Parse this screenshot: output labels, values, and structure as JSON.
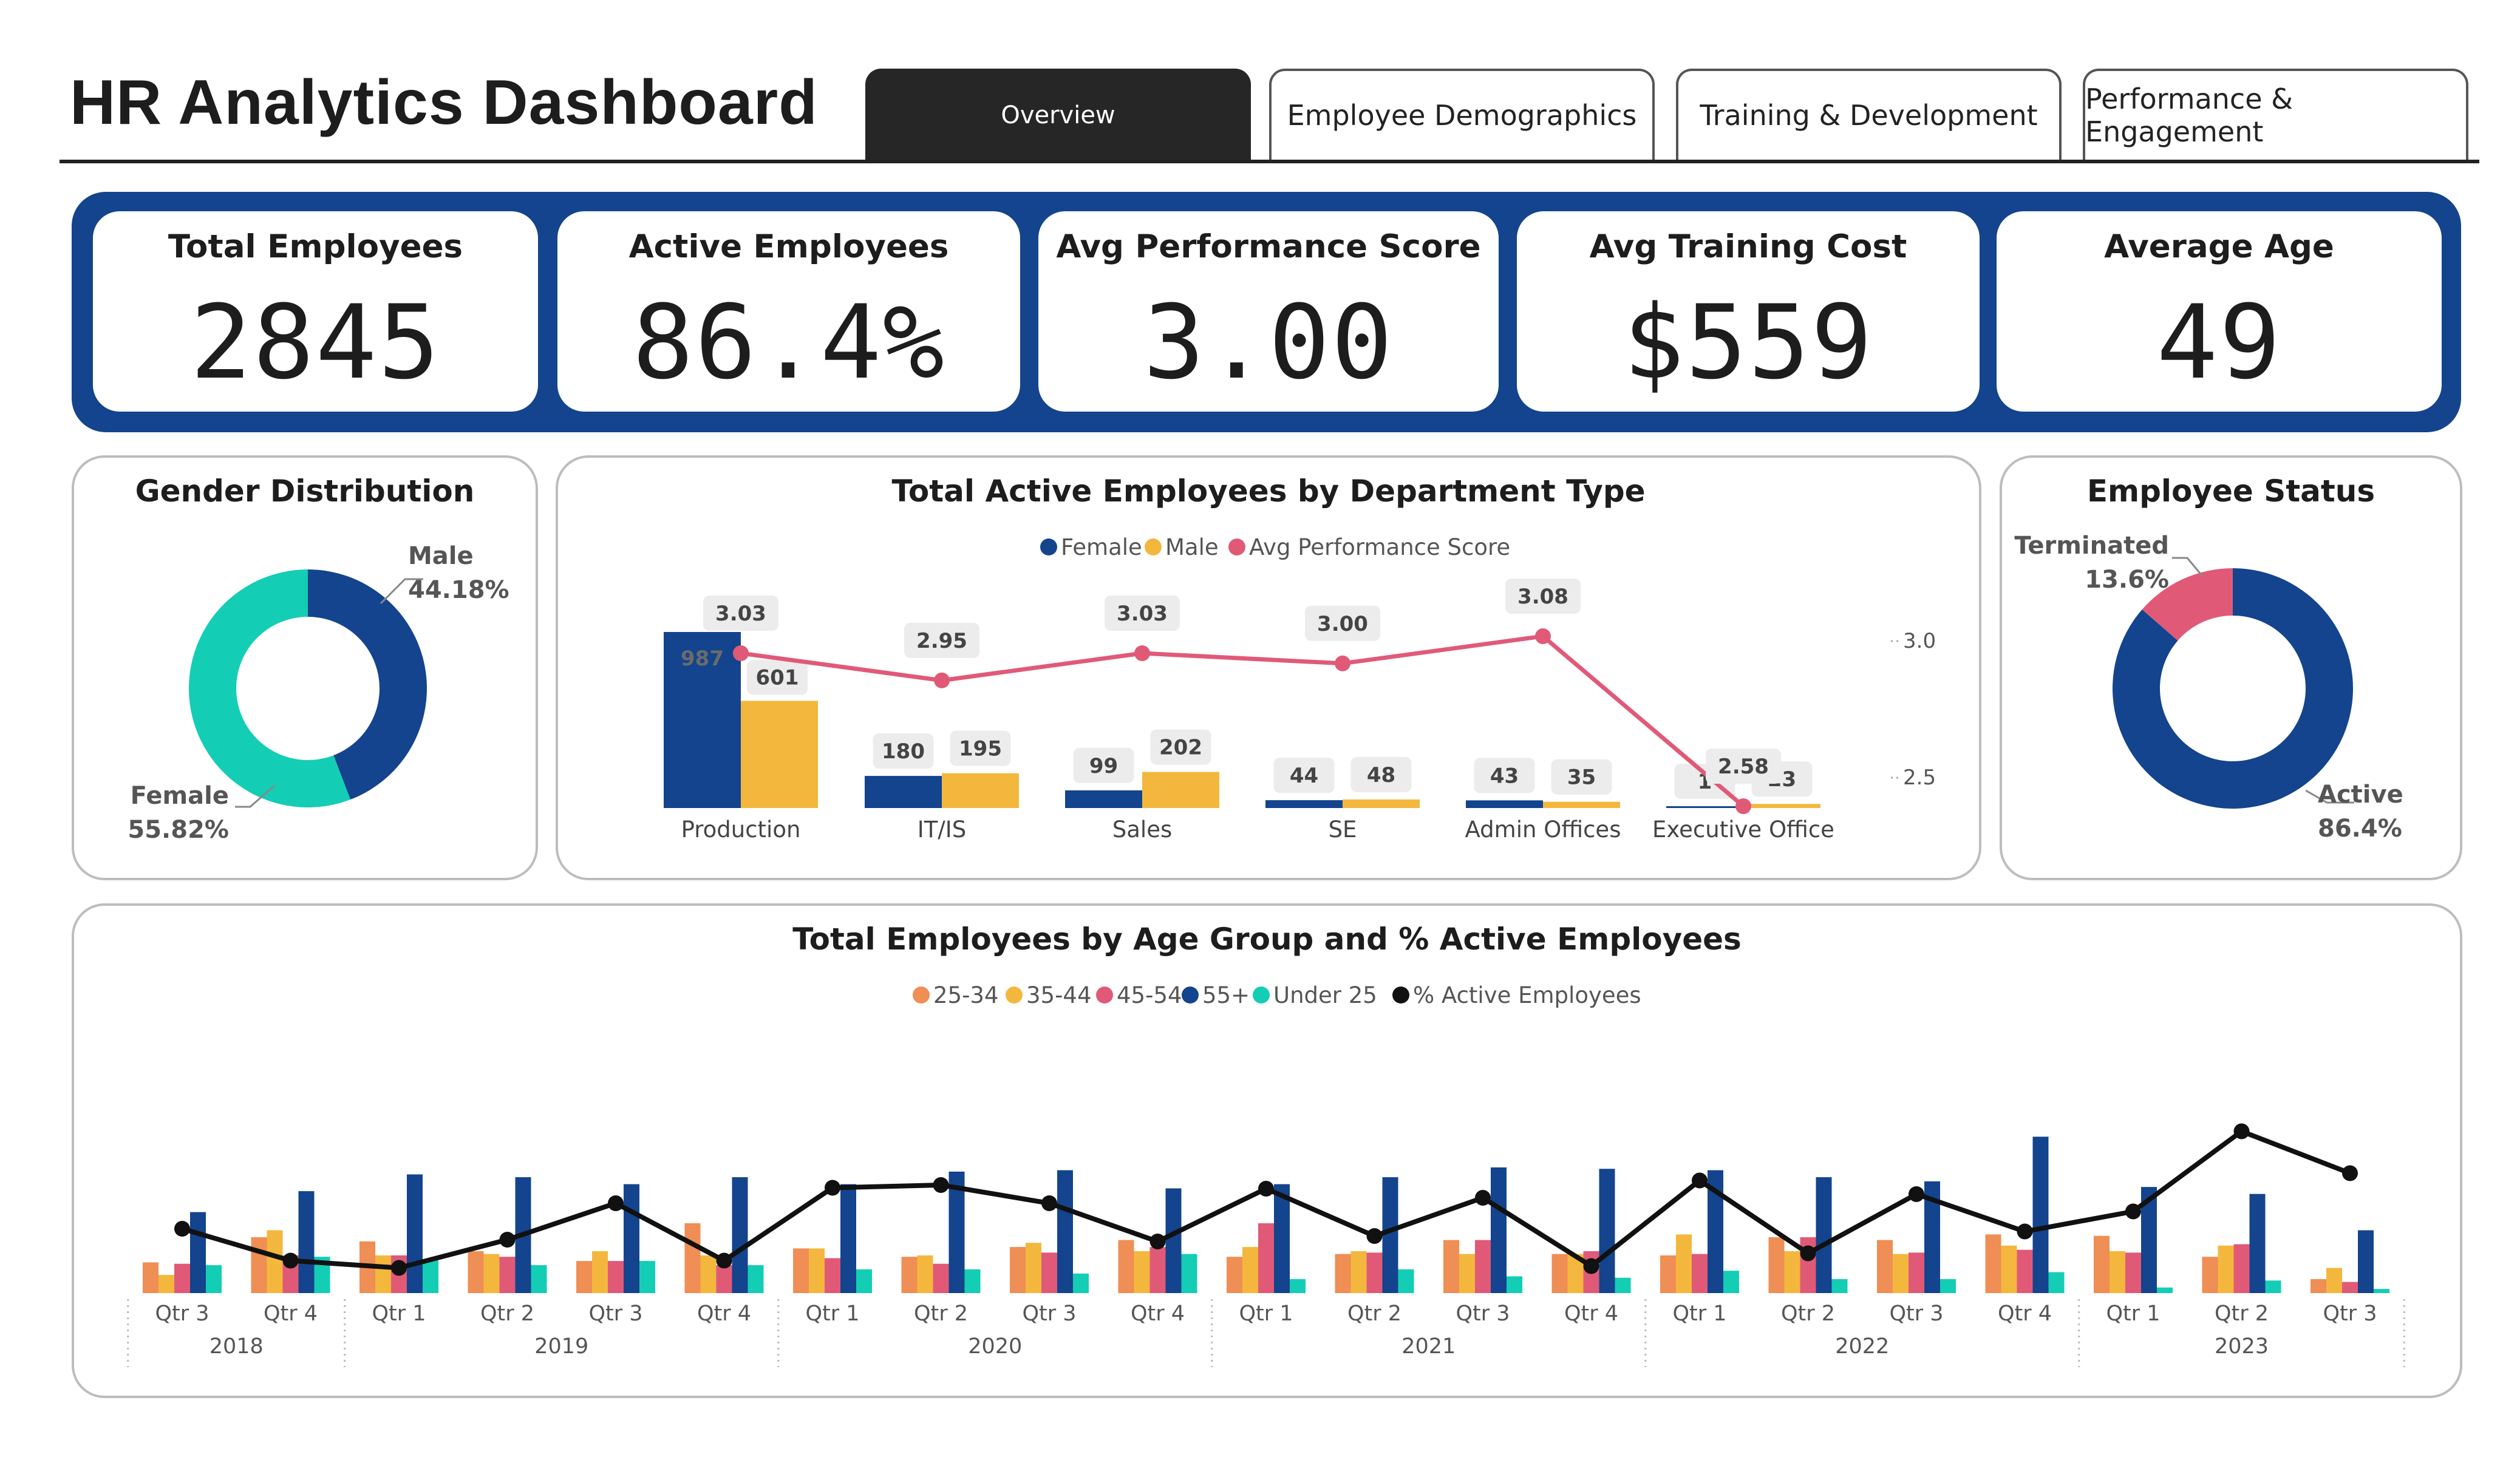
{
  "header": {
    "title": "HR Analytics Dashboard",
    "tabs": [
      {
        "label": "Overview",
        "active": true
      },
      {
        "label": "Employee Demographics",
        "active": false
      },
      {
        "label": "Training & Development",
        "active": false
      },
      {
        "label": "Performance & Engagement",
        "active": false
      }
    ]
  },
  "kpis": [
    {
      "label": "Total Employees",
      "value": "2845"
    },
    {
      "label": "Active Employees",
      "value": "86.4%"
    },
    {
      "label": "Avg Performance Score",
      "value": "3.00"
    },
    {
      "label": "Avg Training Cost",
      "value": "$559"
    },
    {
      "label": "Average Age",
      "value": "49"
    }
  ],
  "colors": {
    "navy": "#13448d",
    "gold": "#f4b73d",
    "pink": "#e05a78",
    "orange": "#ef8e55",
    "teal": "#14cdb5",
    "black": "#111111"
  },
  "chart_data": [
    {
      "type": "pie",
      "title": "Gender Distribution",
      "labels": [
        "Male",
        "Female"
      ],
      "values": [
        44.18,
        55.82
      ],
      "value_labels": [
        "44.18%",
        "55.82%"
      ],
      "colors": [
        "#13448d",
        "#14cdb5"
      ]
    },
    {
      "type": "bar",
      "title": "Total Active Employees by Department Type",
      "categories": [
        "Production",
        "IT/IS",
        "Sales",
        "SE",
        "Admin Offices",
        "Executive Office"
      ],
      "series": [
        {
          "name": "Female",
          "values": [
            987,
            180,
            99,
            44,
            43,
            1
          ]
        },
        {
          "name": "Male",
          "values": [
            601,
            195,
            202,
            48,
            35,
            23
          ]
        },
        {
          "name": "Avg Performance Score",
          "values": [
            3.03,
            2.95,
            3.03,
            3.0,
            3.08,
            2.58
          ],
          "type": "line"
        }
      ],
      "score_labels": [
        "3.03",
        "2.95",
        "3.03",
        "3.00",
        "3.08",
        "2.58"
      ],
      "y2_ticks": [
        "3.0",
        "2.5"
      ],
      "legend": "top-center"
    },
    {
      "type": "pie",
      "title": "Employee Status",
      "labels": [
        "Active",
        "Terminated"
      ],
      "values": [
        86.4,
        13.6
      ],
      "value_labels": [
        "86.4%",
        "13.6%"
      ],
      "colors": [
        "#13448d",
        "#e05a78"
      ]
    },
    {
      "type": "bar",
      "title": "Total Employees by Age Group and % Active Employees",
      "legend": "top-center",
      "categories": [
        "Qtr 3",
        "Qtr 4",
        "Qtr 1",
        "Qtr 2",
        "Qtr 3",
        "Qtr 4",
        "Qtr 1",
        "Qtr 2",
        "Qtr 3",
        "Qtr 4",
        "Qtr 1",
        "Qtr 2",
        "Qtr 3",
        "Qtr 4",
        "Qtr 1",
        "Qtr 2",
        "Qtr 3",
        "Qtr 4",
        "Qtr 1",
        "Qtr 2",
        "Qtr 3"
      ],
      "years": [
        {
          "label": "2018",
          "count": 2
        },
        {
          "label": "2019",
          "count": 4
        },
        {
          "label": "2020",
          "count": 4
        },
        {
          "label": "2021",
          "count": 4
        },
        {
          "label": "2022",
          "count": 4
        },
        {
          "label": "2023",
          "count": 3
        }
      ],
      "series": [
        {
          "name": "25-34",
          "values": [
            22,
            40,
            37,
            30,
            23,
            50,
            32,
            26,
            33,
            38,
            26,
            28,
            38,
            28,
            27,
            40,
            38,
            42,
            41,
            26,
            10
          ]
        },
        {
          "name": "35-44",
          "values": [
            13,
            45,
            27,
            28,
            30,
            27,
            32,
            27,
            36,
            30,
            33,
            30,
            28,
            28,
            42,
            30,
            28,
            34,
            30,
            34,
            18
          ]
        },
        {
          "name": "45-54",
          "values": [
            21,
            27,
            27,
            26,
            23,
            20,
            25,
            21,
            29,
            33,
            50,
            29,
            38,
            30,
            28,
            40,
            29,
            31,
            29,
            35,
            8
          ]
        },
        {
          "name": "55+",
          "values": [
            58,
            73,
            85,
            83,
            78,
            83,
            78,
            87,
            88,
            75,
            78,
            83,
            90,
            89,
            88,
            83,
            80,
            112,
            76,
            71,
            45
          ]
        },
        {
          "name": "Under 25",
          "values": [
            20,
            26,
            24,
            20,
            23,
            20,
            17,
            17,
            14,
            28,
            10,
            17,
            12,
            11,
            16,
            10,
            10,
            15,
            4,
            9,
            3
          ]
        },
        {
          "name": "% Active Employees",
          "values": [
            0.7,
            0.35,
            0.27,
            0.58,
            0.98,
            0.35,
            1.15,
            1.18,
            0.98,
            0.56,
            1.14,
            0.62,
            1.04,
            0.29,
            1.23,
            0.43,
            1.08,
            0.67,
            0.89,
            1.77,
            1.31
          ],
          "type": "line"
        }
      ]
    }
  ]
}
